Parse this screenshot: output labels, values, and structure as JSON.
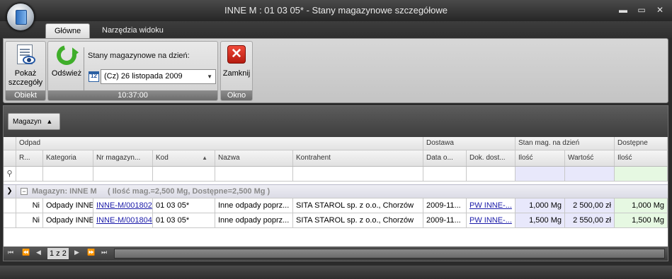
{
  "window": {
    "title": "INNE M : 01 03 05* - Stany magazynowe szczegółowe",
    "minimize": "▬",
    "maximize": "▭",
    "close": "✕"
  },
  "ribbon": {
    "tabs": [
      {
        "label": "Główne",
        "active": true
      },
      {
        "label": "Narzędzia widoku",
        "active": false
      }
    ],
    "groups": {
      "obiekt": {
        "label": "Obiekt",
        "show_details": "Pokaż szczegóły"
      },
      "refresh": {
        "label": "10:37:00",
        "refresh_button": "Odśwież",
        "date_label": "Stany magazynowe na dzień:",
        "date_value": "(Cz) 26 listopada 2009",
        "calendar_day": "12"
      },
      "okno": {
        "label": "Okno",
        "close_button": "Zamknij"
      }
    }
  },
  "grid": {
    "group_chip": "Magazyn",
    "bands": {
      "odpad": "Odpad",
      "dostawa": "Dostawa",
      "stan": "Stan mag. na dzień",
      "dostepne": "Dostępne"
    },
    "columns": {
      "r": "R...",
      "kategoria": "Kategoria",
      "nr_magazyn": "Nr magazyn...",
      "kod": "Kod",
      "nazwa": "Nazwa",
      "kontrahent": "Kontrahent",
      "data_o": "Data o...",
      "dok_dost": "Dok. dost...",
      "ilosc": "Ilość",
      "wartosc": "Wartość",
      "ilosc_dost": "Ilość"
    },
    "group_row": {
      "label": "Magazyn:  INNE M",
      "summary": "( Ilość mag.=2,500 Mg, Dostępne=2,500 Mg )"
    },
    "rows": [
      {
        "r": "Ni",
        "kategoria": "Odpady INNE",
        "nr_magazyn": "INNE-M/001802",
        "kod": "01 03 05*",
        "nazwa": "Inne odpady poprz...",
        "kontrahent": "SITA STAROL sp. z o.o., Chorzów",
        "data_o": "2009-11...",
        "dok_dost": "PW INNE-...",
        "ilosc": "1,000 Mg",
        "wartosc": "2 500,00 zł",
        "ilosc_dost": "1,000 Mg"
      },
      {
        "r": "Ni",
        "kategoria": "Odpady INNE",
        "nr_magazyn": "INNE-M/001804",
        "kod": "01 03 05*",
        "nazwa": "Inne odpady poprz...",
        "kontrahent": "SITA STAROL sp. z o.o., Chorzów",
        "data_o": "2009-11...",
        "dok_dost": "PW INNE-...",
        "ilosc": "1,500 Mg",
        "wartosc": "2 550,00 zł",
        "ilosc_dost": "1,500 Mg"
      }
    ],
    "pager": "1 z 2"
  }
}
